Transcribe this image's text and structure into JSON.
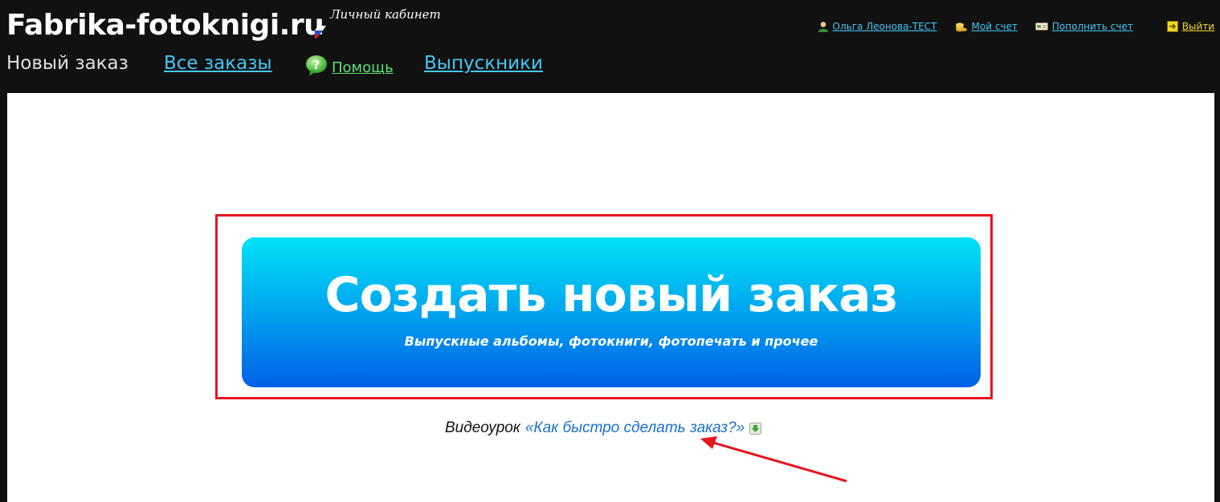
{
  "header": {
    "logo": "Fabrika-fotoknigi.ru",
    "cabinet_label": "Личный кабинет",
    "nav": {
      "current": "Новый заказ",
      "all_orders": "Все заказы",
      "help": "Помощь",
      "graduates": "Выпускники"
    },
    "top_links": {
      "user": "Ольга Леонова-ТЕСТ",
      "account": "Мой счет",
      "topup": "Пополнить счет",
      "exit": "Выйти"
    }
  },
  "main": {
    "create_button": {
      "title": "Создать новый заказ",
      "subtitle": "Выпускные альбомы, фотокниги, фотопечать и прочее"
    },
    "video": {
      "prefix": "Видеоурок",
      "link": "«Как быстро сделать заказ?»"
    }
  },
  "colors": {
    "header_bg": "#111111",
    "link_blue": "#44c8f5",
    "help_green": "#5fe07a",
    "exit_yellow": "#f5d820",
    "annotation_red": "#e8151f",
    "cta_top": "#00e2f6",
    "cta_bottom": "#0060e6"
  },
  "icons": [
    "user-icon",
    "coins-icon",
    "wallet-icon",
    "exit-icon",
    "help-bubble-icon",
    "download-icon",
    "flag-icon"
  ]
}
